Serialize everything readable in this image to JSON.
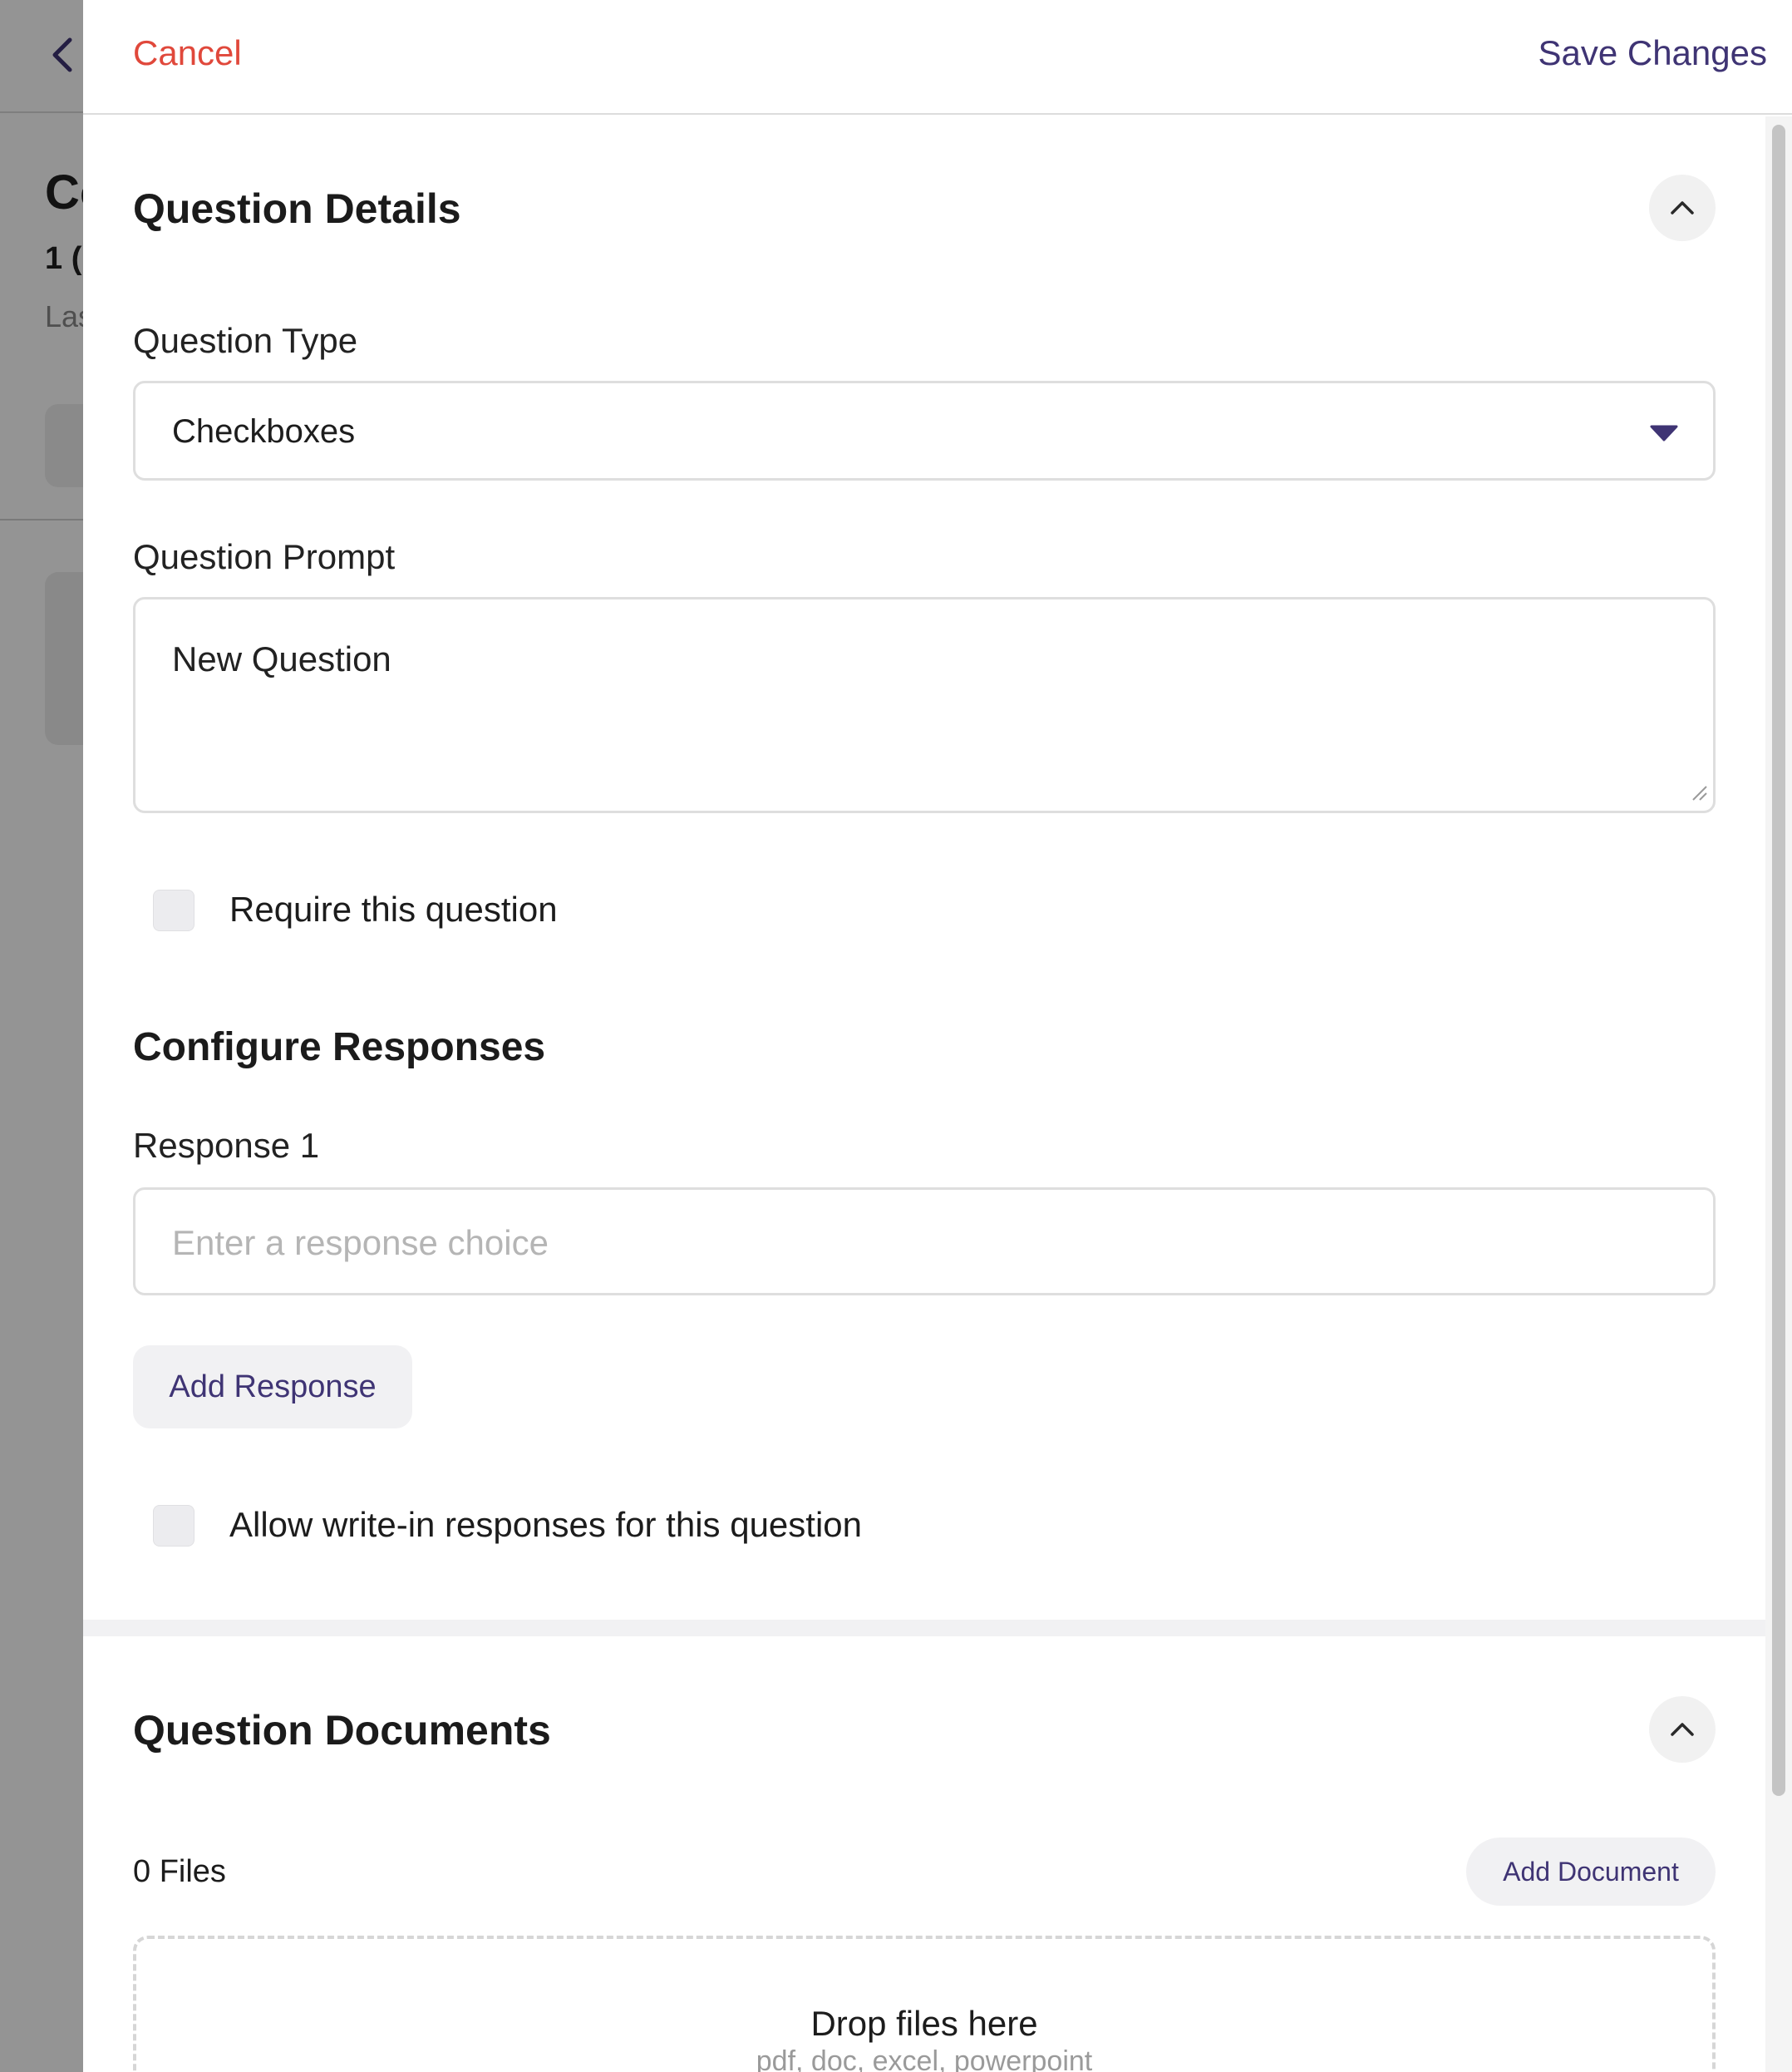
{
  "background": {
    "title_fragment": "Co",
    "subtitle_fragment": "1 (",
    "meta_fragment": "Las"
  },
  "drawer": {
    "cancel_label": "Cancel",
    "save_label": "Save Changes"
  },
  "question_details": {
    "title": "Question Details",
    "question_type_label": "Question Type",
    "question_type_value": "Checkboxes",
    "question_prompt_label": "Question Prompt",
    "question_prompt_value": "New Question",
    "require_label": "Require this question"
  },
  "configure_responses": {
    "title": "Configure Responses",
    "response_label": "Response 1",
    "response_placeholder": "Enter a response choice",
    "add_response_label": "Add Response",
    "write_in_label": "Allow write-in responses for this question"
  },
  "question_documents": {
    "title": "Question Documents",
    "files_count": "0 Files",
    "add_document_label": "Add Document",
    "dropzone_title": "Drop files here",
    "dropzone_subtitle": "pdf, doc, excel, powerpoint"
  },
  "colors": {
    "accent": "#3f3474",
    "cancel": "#e0483b"
  },
  "icons": {
    "back": "chevron-left-icon",
    "collapse": "chevron-up-icon",
    "dropdown": "caret-down-icon",
    "resize": "resize-grip-icon"
  }
}
